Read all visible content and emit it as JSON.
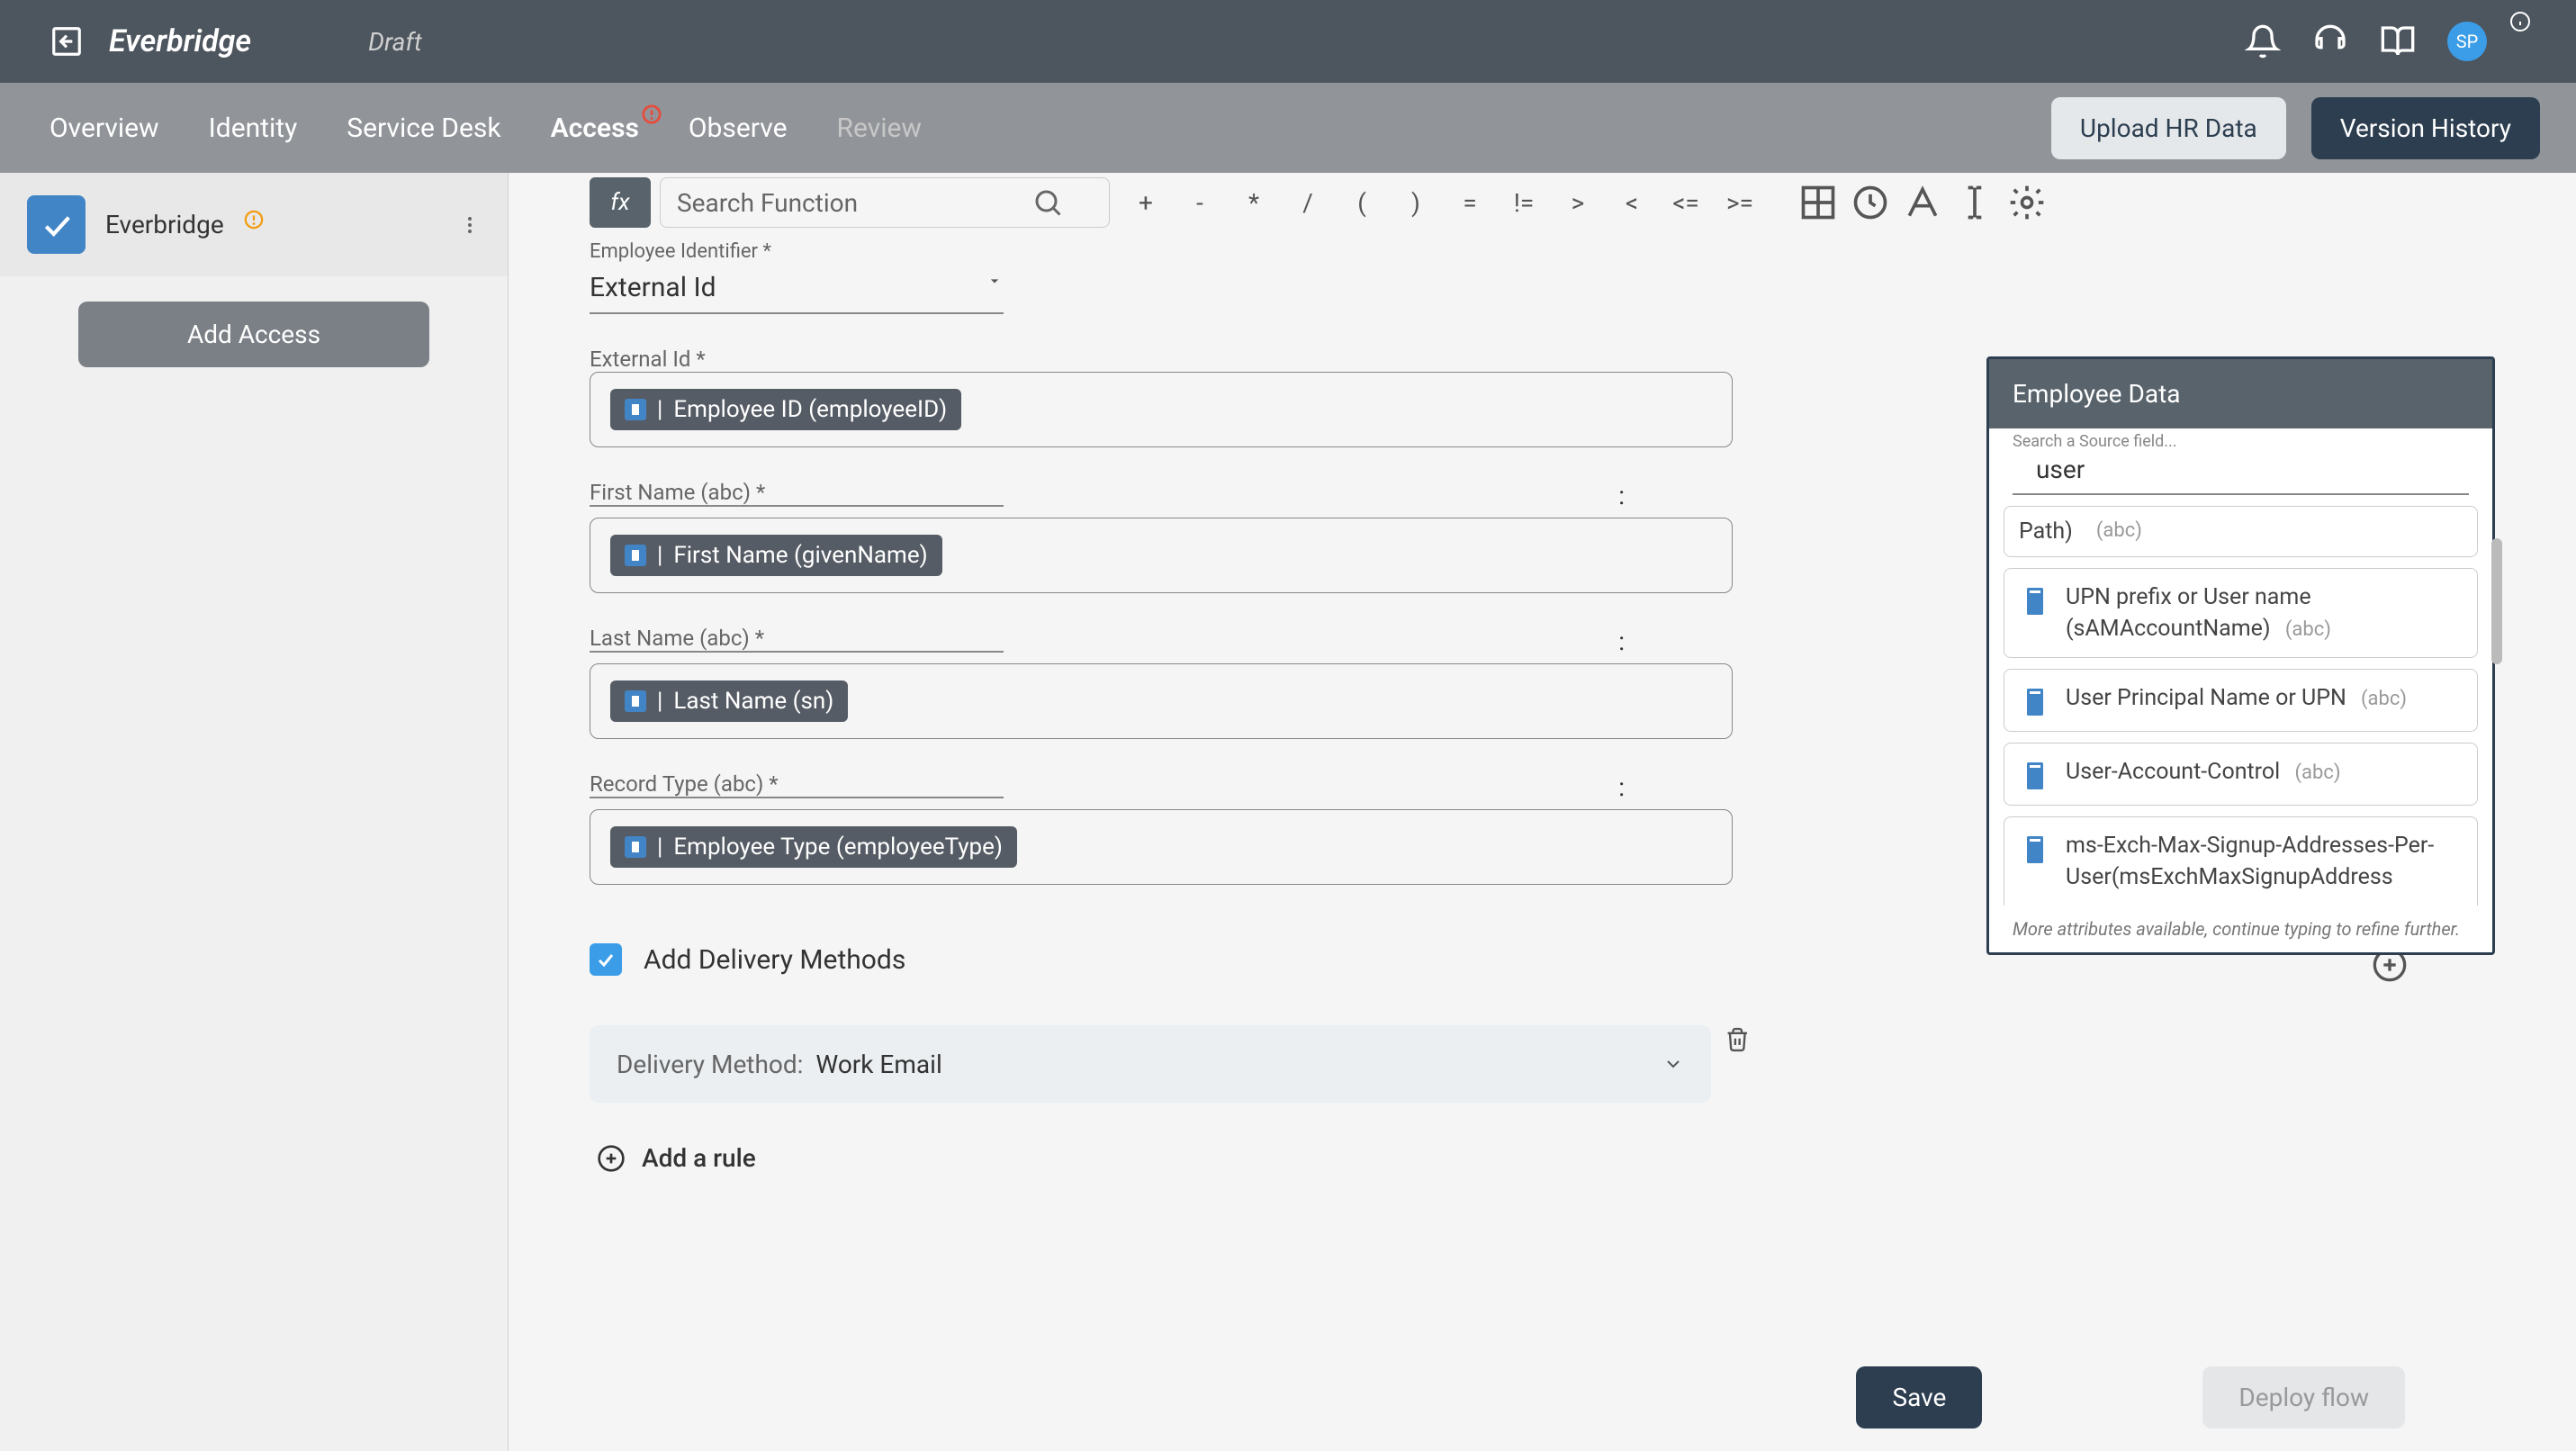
{
  "header": {
    "brand": "Everbridge",
    "status": "Draft",
    "avatar": "SP"
  },
  "nav": {
    "tabs": [
      "Overview",
      "Identity",
      "Service Desk",
      "Access",
      "Observe",
      "Review"
    ],
    "upload": "Upload HR Data",
    "version": "Version History"
  },
  "sidebar": {
    "app_name": "Everbridge",
    "add_access": "Add Access"
  },
  "fx": {
    "search_placeholder": "Search Function",
    "ops": [
      "+",
      "-",
      "*",
      "/",
      "(",
      ")",
      "=",
      "!=",
      ">",
      "<",
      "<=",
      ">="
    ]
  },
  "form": {
    "emp_id_label": "Employee Identifier *",
    "emp_id_value": "External Id",
    "ext_id_label": "External Id *",
    "ext_id_chip": "Employee ID (employeeID)",
    "first_name_label": "First Name (abc) *",
    "first_name_chip": "First Name (givenName)",
    "last_name_label": "Last Name (abc) *",
    "last_name_chip": "Last Name (sn)",
    "record_type_label": "Record Type (abc) *",
    "record_type_chip": "Employee Type (employeeType)",
    "add_delivery": "Add Delivery Methods",
    "delivery_label": "Delivery Method:",
    "delivery_value": "Work Email",
    "add_rule": "Add a rule"
  },
  "right_panel": {
    "title": "Employee Data",
    "search_label": "Search a Source field...",
    "search_value": "user",
    "items": [
      {
        "name": "Path)",
        "type": "(abc)"
      },
      {
        "name": "UPN prefix or User name (sAMAccountName)",
        "type": "(abc)"
      },
      {
        "name": "User Principal Name or UPN",
        "type": "(abc)"
      },
      {
        "name": "User-Account-Control",
        "type": "(abc)"
      },
      {
        "name": "ms-Exch-Max-Signup-Addresses-Per-User(msExchMaxSignupAddress",
        "type": ""
      }
    ],
    "footer": "More attributes available, continue typing to refine further."
  },
  "footer": {
    "save": "Save",
    "deploy": "Deploy flow"
  },
  "colors": {
    "header_bg": "#4d555e",
    "nav_bg": "#919499",
    "accent": "#3b9de8",
    "dark": "#2c3e50"
  }
}
